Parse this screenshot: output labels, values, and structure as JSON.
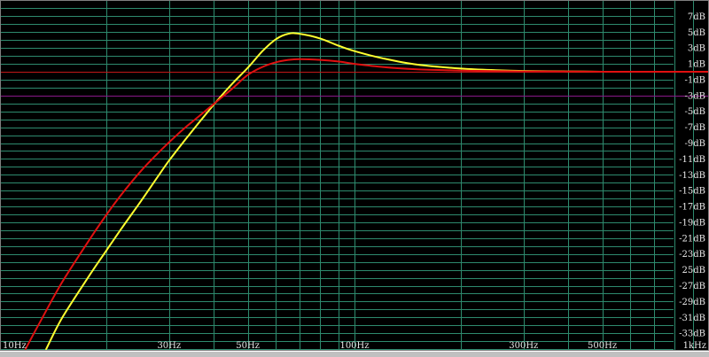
{
  "chart_data": {
    "type": "line",
    "xscale": "log",
    "xlim": [
      10,
      1000
    ],
    "ylim": [
      -35,
      9
    ],
    "grid": true,
    "x_ticks": [
      {
        "value": 10,
        "label": "10Hz"
      },
      {
        "value": 30,
        "label": "30Hz"
      },
      {
        "value": 50,
        "label": "50Hz"
      },
      {
        "value": 100,
        "label": "100Hz"
      },
      {
        "value": 300,
        "label": "300Hz"
      },
      {
        "value": 500,
        "label": "500Hz"
      },
      {
        "value": 1000,
        "label": "1kHz"
      }
    ],
    "y_ticks": [
      {
        "value": 7,
        "label": "7dB"
      },
      {
        "value": 5,
        "label": "5dB"
      },
      {
        "value": 3,
        "label": "3dB"
      },
      {
        "value": 1,
        "label": "1dB"
      },
      {
        "value": -1,
        "label": "-1dB"
      },
      {
        "value": -3,
        "label": "-3dB"
      },
      {
        "value": -5,
        "label": "-5dB"
      },
      {
        "value": -7,
        "label": "-7dB"
      },
      {
        "value": -9,
        "label": "-9dB"
      },
      {
        "value": -11,
        "label": "-11dB"
      },
      {
        "value": -13,
        "label": "-13dB"
      },
      {
        "value": -15,
        "label": "-15dB"
      },
      {
        "value": -17,
        "label": "-17dB"
      },
      {
        "value": -19,
        "label": "-19dB"
      },
      {
        "value": -21,
        "label": "-21dB"
      },
      {
        "value": -23,
        "label": "-23dB"
      },
      {
        "value": -25,
        "label": "25dB"
      },
      {
        "value": -27,
        "label": "-27dB"
      },
      {
        "value": -29,
        "label": "-29dB"
      },
      {
        "value": -31,
        "label": "-31dB"
      },
      {
        "value": -33,
        "label": "-33dB"
      }
    ],
    "reference_lines": [
      {
        "value": 0,
        "color": "#c01818"
      },
      {
        "value": -3,
        "color": "#8a1a8a"
      }
    ],
    "series": [
      {
        "color": "#ffff30",
        "x": [
          13.5,
          15,
          18,
          20,
          22,
          25,
          28,
          30,
          33,
          36,
          40,
          45,
          50,
          55,
          60,
          65,
          70,
          80,
          90,
          100,
          120,
          150,
          200,
          250,
          300,
          400,
          500,
          700,
          1000
        ],
        "y": [
          -35,
          -31,
          -25.5,
          -22.5,
          -19.8,
          -16.3,
          -13.1,
          -11.2,
          -8.8,
          -6.7,
          -4.2,
          -1.6,
          0.5,
          2.6,
          4.1,
          4.8,
          4.8,
          4.2,
          3.3,
          2.6,
          1.7,
          0.9,
          0.4,
          0.2,
          0.1,
          0.05,
          0,
          0,
          0
        ]
      },
      {
        "color": "#e01010",
        "x": [
          11.8,
          13,
          15,
          18,
          20,
          22,
          25,
          28,
          30,
          33,
          36,
          40,
          45,
          50,
          55,
          60,
          65,
          70,
          80,
          90,
          100,
          120,
          150,
          200,
          250,
          300,
          400,
          500,
          700,
          1000
        ],
        "y": [
          -35,
          -31.5,
          -26.5,
          -21,
          -18,
          -15.5,
          -12.5,
          -10.2,
          -8.9,
          -7.2,
          -5.8,
          -4.1,
          -2.2,
          -0.4,
          0.6,
          1.2,
          1.5,
          1.6,
          1.5,
          1.3,
          1.0,
          0.6,
          0.3,
          0.15,
          0.08,
          0.05,
          0.02,
          0,
          0,
          0
        ]
      }
    ]
  }
}
